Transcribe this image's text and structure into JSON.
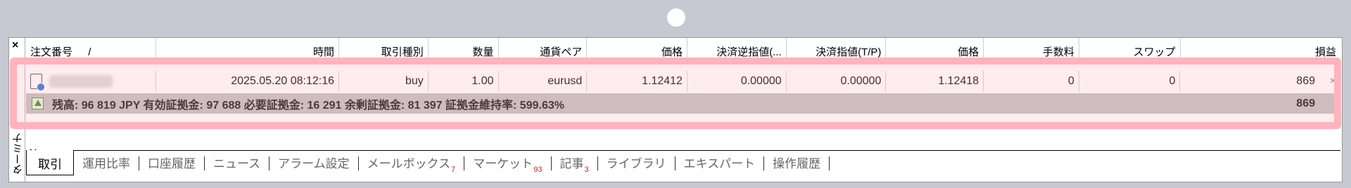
{
  "terminal": {
    "side_label": "ターミナル",
    "close_label": "×"
  },
  "columns": [
    "注文番号",
    "時間",
    "取引種別",
    "数量",
    "通貨ペア",
    "価格",
    "決済逆指値(...",
    "決済指値(T/P)",
    "価格",
    "手数料",
    "スワップ",
    "損益"
  ],
  "sort_indicator": "/",
  "order_row": {
    "time": "2025.05.20 08:12:16",
    "type": "buy",
    "volume": "1.00",
    "symbol": "eurusd",
    "open_price": "1.12412",
    "sl": "0.00000",
    "tp": "0.00000",
    "price": "1.12418",
    "commission": "0",
    "swap": "0",
    "profit": "869",
    "close_label": "×"
  },
  "summary": {
    "text": "残高: 96 819 JPY  有効証拠金: 97 688  必要証拠金: 16 291  余剰証拠金: 81 397  証拠金維持率: 599.63%",
    "profit": "869"
  },
  "tabs": [
    {
      "label": "取引",
      "badge": ""
    },
    {
      "label": "運用比率",
      "badge": ""
    },
    {
      "label": "口座履歴",
      "badge": ""
    },
    {
      "label": "ニュース",
      "badge": ""
    },
    {
      "label": "アラーム設定",
      "badge": ""
    },
    {
      "label": "メールボックス",
      "badge": "7"
    },
    {
      "label": "マーケット",
      "badge": "93"
    },
    {
      "label": "記事",
      "badge": "3"
    },
    {
      "label": "ライブラリ",
      "badge": ""
    },
    {
      "label": "エキスパート",
      "badge": ""
    },
    {
      "label": "操作履歴",
      "badge": ""
    }
  ],
  "colors": {
    "highlight": "#ffb3bc",
    "summary_bg": "#bfbfbf",
    "badge": "#d02020"
  }
}
